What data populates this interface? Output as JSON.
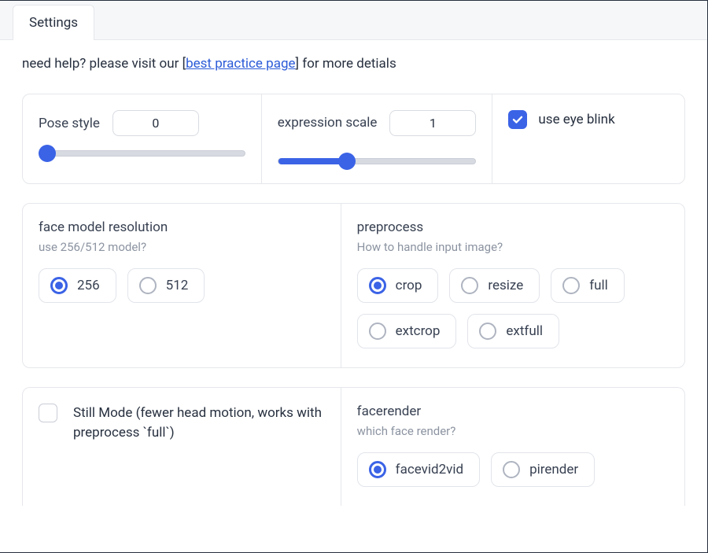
{
  "tabs": {
    "active": "Settings"
  },
  "help": {
    "prefix": "need help? please visit our [",
    "link_text": "best practice page",
    "suffix": "] for more detials"
  },
  "pose": {
    "label": "Pose style",
    "value": "0",
    "slider_pct": 4
  },
  "expr": {
    "label": "expression scale",
    "value": "1",
    "slider_pct": 35
  },
  "eyeblink": {
    "label": "use eye blink",
    "checked": true
  },
  "face_res": {
    "title": "face model resolution",
    "subtitle": "use 256/512 model?",
    "options": [
      "256",
      "512"
    ],
    "selected": "256"
  },
  "preprocess": {
    "title": "preprocess",
    "subtitle": "How to handle input image?",
    "options": [
      "crop",
      "resize",
      "full",
      "extcrop",
      "extfull"
    ],
    "selected": "crop"
  },
  "still": {
    "label": "Still Mode (fewer head motion, works with preprocess `full`)",
    "checked": false
  },
  "facerender": {
    "title": "facerender",
    "subtitle": "which face render?",
    "options": [
      "facevid2vid",
      "pirender"
    ],
    "selected": "facevid2vid"
  }
}
